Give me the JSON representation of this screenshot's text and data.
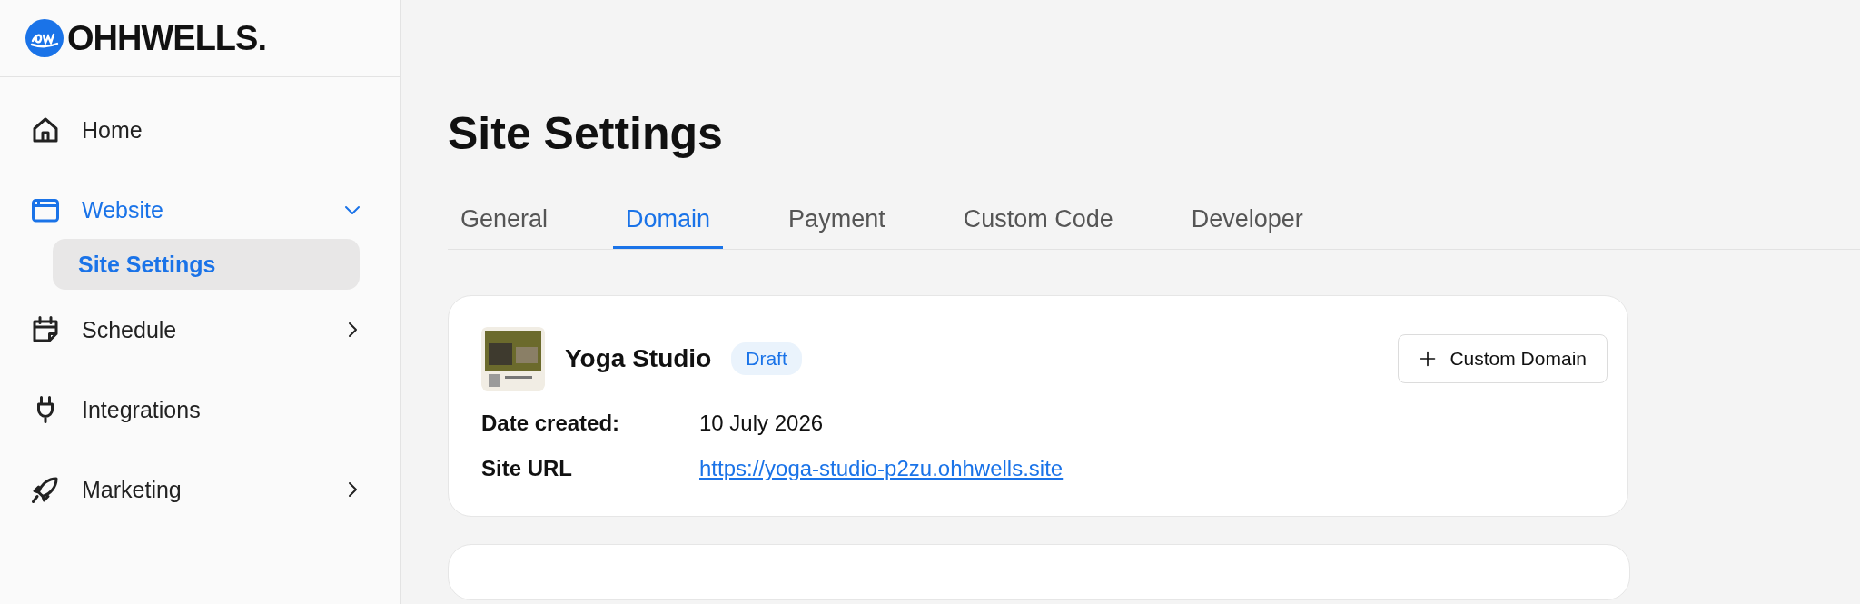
{
  "sidebar": {
    "logo": {
      "text": "OHHWELLS."
    },
    "items": [
      {
        "label": "Home",
        "selected": false
      },
      {
        "label": "Website",
        "selected": true,
        "expanded": true,
        "children": [
          {
            "label": "Site Settings",
            "selected": true
          }
        ]
      },
      {
        "label": "Schedule",
        "selected": false,
        "expanded": false
      },
      {
        "label": "Integrations",
        "selected": false
      },
      {
        "label": "Marketing",
        "selected": false,
        "expanded": false
      }
    ]
  },
  "page": {
    "title": "Site Settings",
    "tabs": [
      {
        "label": "General",
        "selected": false
      },
      {
        "label": "Domain",
        "selected": true
      },
      {
        "label": "Payment",
        "selected": false
      },
      {
        "label": "Custom Code",
        "selected": false
      },
      {
        "label": "Developer",
        "selected": false
      }
    ],
    "site_card": {
      "name": "Yoga Studio",
      "status": "Draft",
      "button": "Custom Domain",
      "fields": [
        {
          "label": "Date created:",
          "value": "10 July 2026",
          "kind": "text"
        },
        {
          "label": "Site URL",
          "value": "https://yoga-studio-p2zu.ohhwells.site",
          "kind": "link"
        }
      ]
    }
  }
}
